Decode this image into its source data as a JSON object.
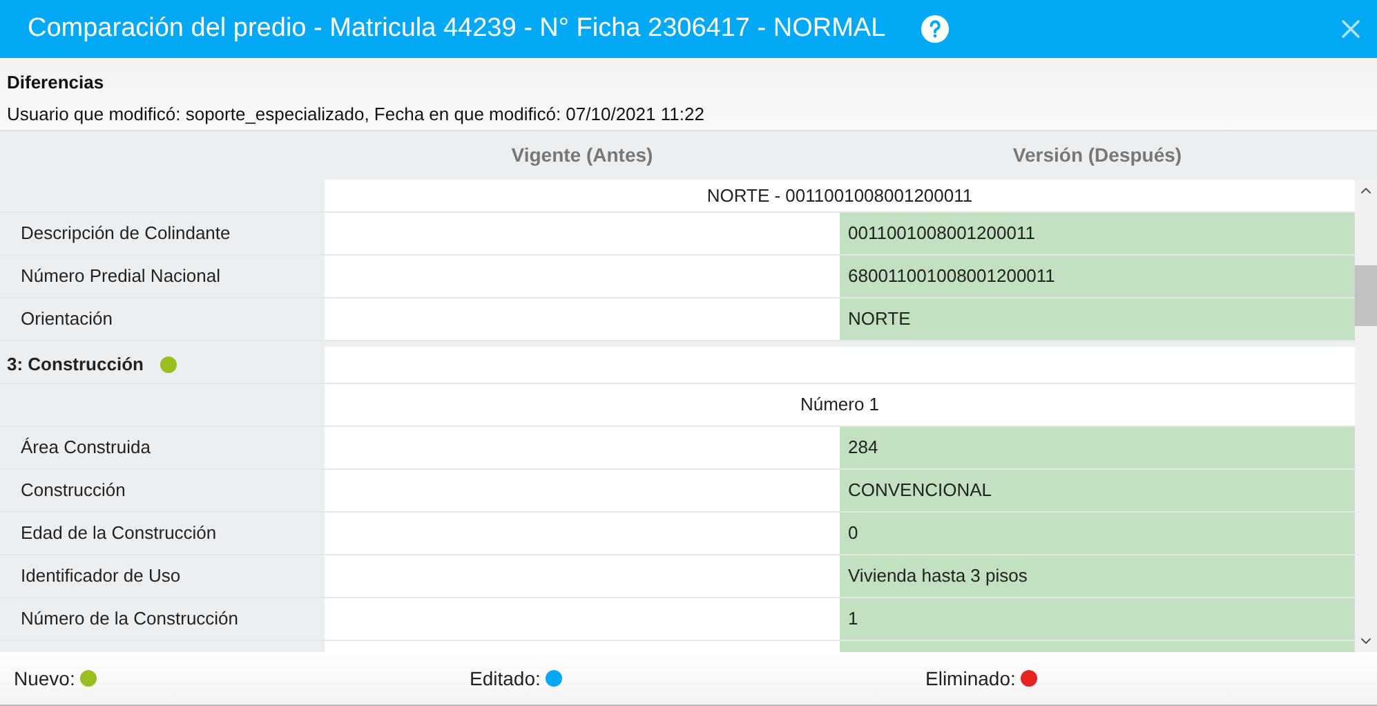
{
  "window": {
    "title": "Comparación del predio - Matricula 44239 - N° Ficha 2306417 - NORMAL"
  },
  "info": {
    "heading": "Diferencias",
    "detail": "Usuario que modificó: soporte_especializado, Fecha en que modificó: 07/10/2021 11:22"
  },
  "table": {
    "columns": [
      "Vigente (Antes)",
      "Versión (Después)"
    ],
    "rows": [
      {
        "kind": "group",
        "text": "NORTE - 0011001008001200011"
      },
      {
        "kind": "field",
        "label": "Descripción de Colindante",
        "after": "0011001008001200011",
        "color": "#c1e1c1"
      },
      {
        "kind": "field",
        "label": "Número Predial Nacional",
        "after": "680011001008001200011",
        "color": "#c1e1c1"
      },
      {
        "kind": "field",
        "label": "Orientación",
        "after": "NORTE",
        "color": "#c1e1c1"
      },
      {
        "kind": "section",
        "label": "3: Construcción",
        "color": "#97c11f"
      },
      {
        "kind": "group",
        "text": "Número 1"
      },
      {
        "kind": "field",
        "label": "Área Construida",
        "after": "284",
        "color": "#c1e1c1"
      },
      {
        "kind": "field",
        "label": "Construcción",
        "after": "CONVENCIONAL",
        "color": "#c1e1c1"
      },
      {
        "kind": "field",
        "label": "Edad de la Construcción",
        "after": "0",
        "color": "#c1e1c1"
      },
      {
        "kind": "field",
        "label": "Identificador de Uso",
        "after": "Vivienda hasta 3 pisos",
        "color": "#c1e1c1"
      },
      {
        "kind": "field",
        "label": "Número de la Construcción",
        "after": "1",
        "color": "#c1e1c1"
      }
    ]
  },
  "legend": [
    {
      "label": "Nuevo:",
      "color": "#97c11f"
    },
    {
      "label": "Editado:",
      "color": "#03a9f4"
    },
    {
      "label": "Eliminado:",
      "color": "#e52421"
    }
  ]
}
